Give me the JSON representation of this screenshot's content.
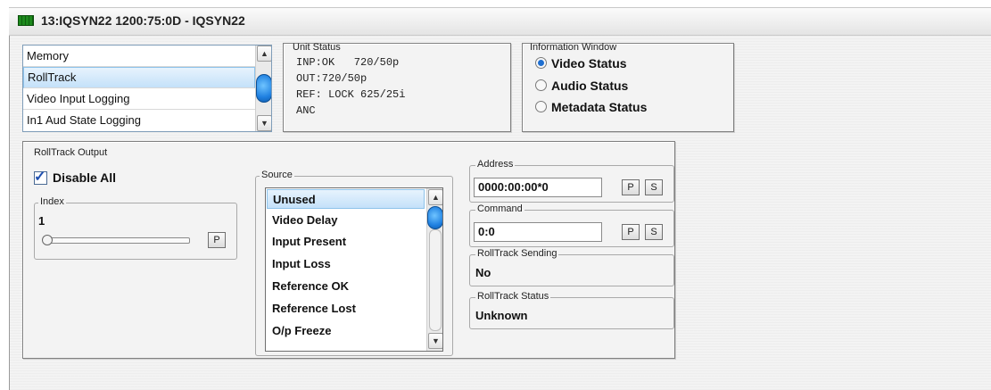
{
  "window": {
    "title": "13:IQSYN22  1200:75:0D  - IQSYN22"
  },
  "menu_list": {
    "items": [
      {
        "label": "Memory",
        "selected": false
      },
      {
        "label": "RollTrack",
        "selected": true
      },
      {
        "label": "Video Input Logging",
        "selected": false
      },
      {
        "label": "In1 Aud State Logging",
        "selected": false
      }
    ]
  },
  "unit_status": {
    "legend": "Unit Status",
    "lines": [
      "INP:OK   720/50p",
      "OUT:720/50p",
      "REF: LOCK 625/25i",
      "ANC"
    ]
  },
  "info_window": {
    "legend": "Information Window",
    "options": [
      {
        "label": "Video Status",
        "selected": true
      },
      {
        "label": "Audio Status",
        "selected": false
      },
      {
        "label": "Metadata Status",
        "selected": false
      }
    ]
  },
  "rolltrack_output": {
    "legend": "RollTrack Output",
    "disable_all": {
      "label": "Disable All",
      "checked": true
    },
    "index": {
      "legend": "Index",
      "value": "1",
      "p_label": "P"
    },
    "source": {
      "legend": "Source",
      "items": [
        "Unused",
        "Video Delay",
        "Input Present",
        "Input Loss",
        "Reference OK",
        "Reference Lost",
        "O/p Freeze"
      ],
      "selected": "Unused"
    },
    "address": {
      "legend": "Address",
      "value": "0000:00:00*0",
      "p_label": "P",
      "s_label": "S"
    },
    "command": {
      "legend": "Command",
      "value": "0:0",
      "p_label": "P",
      "s_label": "S"
    },
    "sending": {
      "legend": "RollTrack Sending",
      "value": "No"
    },
    "status": {
      "legend": "RollTrack Status",
      "value": "Unknown"
    }
  },
  "colors": {
    "accent": "#1f6fd0",
    "selection": "#c4e1f9",
    "title_icon": "#1d8a1d"
  }
}
